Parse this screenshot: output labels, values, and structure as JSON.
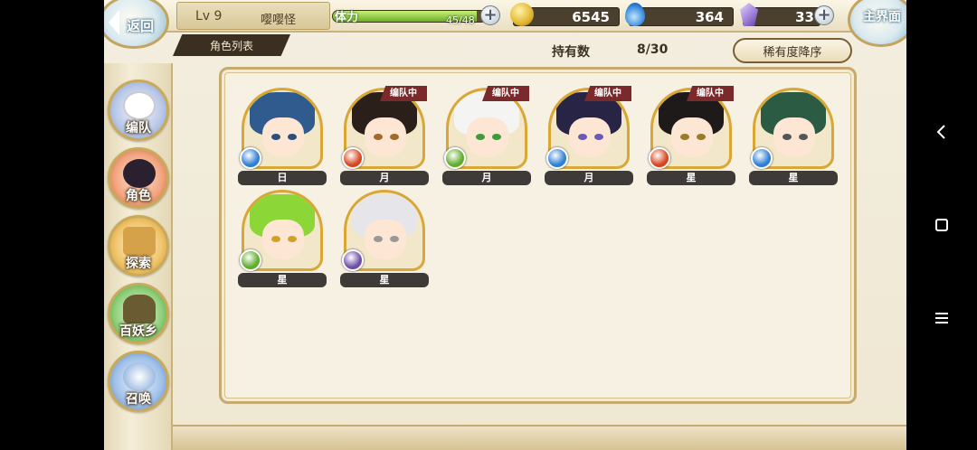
{
  "topbar": {
    "back_label": "返回",
    "level": "Lv 9",
    "player_name": "嘤嘤怪",
    "stamina_label": "体力",
    "stamina_value": "45/48",
    "stamina_fraction": 0.9375,
    "gold": "6545",
    "soul": "364",
    "crystal": "33",
    "home_label": "主界面"
  },
  "tabs": {
    "list_tab": "角色列表"
  },
  "inventory": {
    "held_label": "持有数",
    "held_count": "8/30",
    "sort_label": "稀有度降序"
  },
  "side_menu": [
    {
      "label": "编队",
      "icon": "ghost-icon"
    },
    {
      "label": "角色",
      "icon": "character-icon"
    },
    {
      "label": "探索",
      "icon": "scroll-icon"
    },
    {
      "label": "百妖乡",
      "icon": "village-icon"
    },
    {
      "label": "召唤",
      "icon": "summon-icon"
    }
  ],
  "characters": [
    {
      "rank": "日",
      "tag": "",
      "element": "water",
      "hair": "#2f5b8f",
      "eye": "#2a4f7a"
    },
    {
      "rank": "月",
      "tag": "编队中",
      "element": "fire",
      "hair": "#2a1f19",
      "eye": "#a06b2a"
    },
    {
      "rank": "月",
      "tag": "编队中",
      "element": "wind",
      "hair": "#f4f4f2",
      "eye": "#3e9a3a"
    },
    {
      "rank": "月",
      "tag": "编队中",
      "element": "water",
      "hair": "#272445",
      "eye": "#6c59b6"
    },
    {
      "rank": "星",
      "tag": "编队中",
      "element": "fire",
      "hair": "#1f1a1a",
      "eye": "#9a7b2a"
    },
    {
      "rank": "星",
      "tag": "",
      "element": "water",
      "hair": "#2c5b44",
      "eye": "#555"
    },
    {
      "rank": "星",
      "tag": "",
      "element": "wind",
      "hair": "#8cd637",
      "eye": "#cfa12a"
    },
    {
      "rank": "星",
      "tag": "",
      "element": "dark",
      "hair": "#e6e6ea",
      "eye": "#999"
    }
  ],
  "element_colors": {
    "water": "#2e7fd4",
    "fire": "#d8451f",
    "wind": "#5fae2b",
    "dark": "#6d4fa8"
  }
}
